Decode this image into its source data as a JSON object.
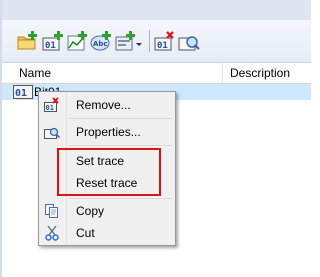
{
  "toolbar": {
    "buttons": [
      {
        "name": "new-folder-icon"
      },
      {
        "name": "add-tag-icon"
      },
      {
        "name": "trend-icon"
      },
      {
        "name": "abc-text-icon"
      },
      {
        "name": "dropdown-tool-icon"
      },
      {
        "name": "remove-tag-icon"
      },
      {
        "name": "properties-icon"
      }
    ]
  },
  "list": {
    "columns": [
      "Name",
      "Description"
    ],
    "selected_row": {
      "name": "Bit01",
      "icon": "bit-tag-icon"
    }
  },
  "context_menu": {
    "items": [
      {
        "label": "Remove...",
        "icon": "remove-icon"
      },
      {
        "label": "Properties...",
        "icon": "properties-icon"
      },
      {
        "label": "Set trace",
        "icon": ""
      },
      {
        "label": "Reset trace",
        "icon": ""
      },
      {
        "label": "Copy",
        "icon": "copy-icon"
      },
      {
        "label": "Cut",
        "icon": "cut-icon"
      }
    ]
  },
  "colors": {
    "selection": "#cde8ff",
    "highlight_border": "#dd1111",
    "menu_background": "#f0f0f0"
  }
}
